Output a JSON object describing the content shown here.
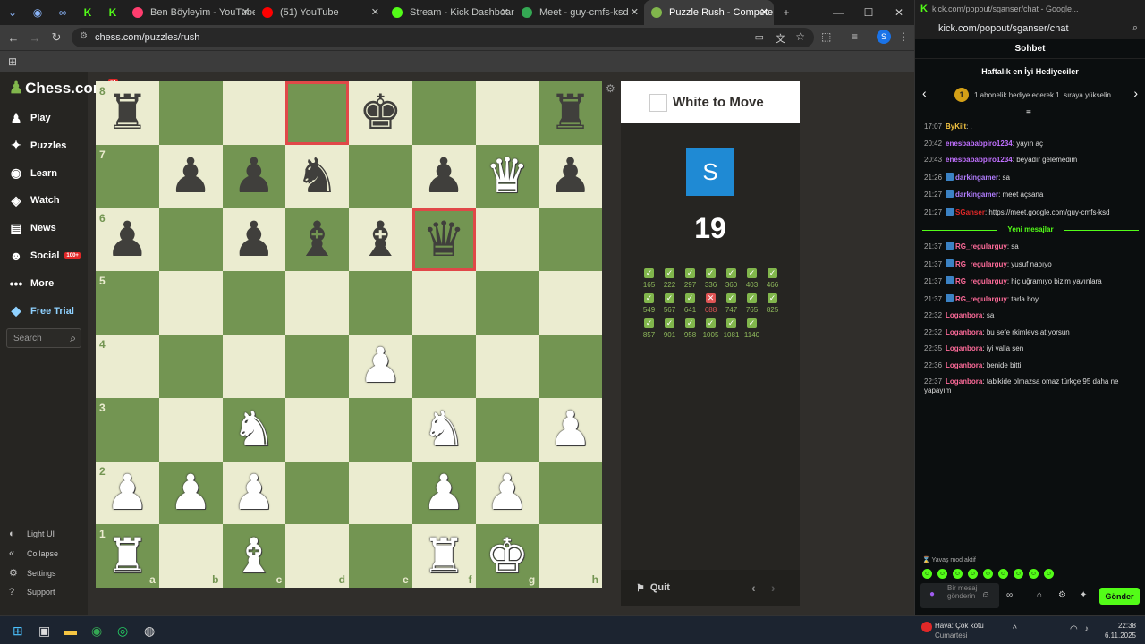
{
  "browser": {
    "tabs": [
      {
        "label": "Ben Böyleyim - YouTube",
        "color": "#ff3d6e"
      },
      {
        "label": "(51) YouTube",
        "color": "#ff0000"
      },
      {
        "label": "Stream - Kick Dashboard",
        "color": "#53fc18"
      },
      {
        "label": "Meet - guy-cmfs-ksd",
        "color": "#34a853"
      },
      {
        "label": "Puzzle Rush - Compete to S",
        "color": "#81b64c",
        "active": true
      }
    ],
    "url": "chess.com/puzzles/rush",
    "profile_initial": "S"
  },
  "sidebar": {
    "logo": "Chess.com",
    "logo_badge": "11",
    "items": [
      {
        "label": "Play",
        "icon": "play-icon",
        "glyph": "♟"
      },
      {
        "label": "Puzzles",
        "icon": "puzzle-icon",
        "glyph": "✦"
      },
      {
        "label": "Learn",
        "icon": "learn-icon",
        "glyph": "◉"
      },
      {
        "label": "Watch",
        "icon": "watch-icon",
        "glyph": "◈"
      },
      {
        "label": "News",
        "icon": "news-icon",
        "glyph": "▤"
      },
      {
        "label": "Social",
        "icon": "social-icon",
        "glyph": "☻",
        "tag": "100+"
      },
      {
        "label": "More",
        "icon": "more-icon",
        "glyph": "•••"
      },
      {
        "label": "Free Trial",
        "icon": "diamond-icon",
        "glyph": "◆"
      }
    ],
    "search_placeholder": "Search",
    "bottom": [
      {
        "label": "Light UI",
        "icon": "light-ui-icon",
        "glyph": "◐"
      },
      {
        "label": "Collapse",
        "icon": "collapse-icon",
        "glyph": "«"
      },
      {
        "label": "Settings",
        "icon": "gear-icon",
        "glyph": "⚙"
      },
      {
        "label": "Support",
        "icon": "help-icon",
        "glyph": "?"
      }
    ]
  },
  "board": {
    "ranks": [
      "8",
      "7",
      "6",
      "5",
      "4",
      "3",
      "2",
      "1"
    ],
    "files": [
      "a",
      "b",
      "c",
      "d",
      "e",
      "f",
      "g",
      "h"
    ],
    "position": [
      [
        "bR",
        "",
        "",
        "",
        "bK",
        "",
        "",
        "bR"
      ],
      [
        "",
        "bP",
        "bP",
        "bN",
        "",
        "bP",
        "wQ",
        "bP"
      ],
      [
        "bP",
        "",
        "bP",
        "bB",
        "bB",
        "bQ",
        "",
        ""
      ],
      [
        "",
        "",
        "",
        "",
        "",
        "",
        "",
        ""
      ],
      [
        "",
        "",
        "",
        "",
        "wP",
        "",
        "",
        ""
      ],
      [
        "",
        "",
        "wN",
        "",
        "",
        "wN",
        "",
        "wP"
      ],
      [
        "wP",
        "wP",
        "wP",
        "",
        "",
        "wP",
        "wP",
        ""
      ],
      [
        "wR",
        "",
        "wB",
        "",
        "",
        "wR",
        "wK",
        ""
      ]
    ],
    "highlighted": [
      "d8",
      "f6"
    ]
  },
  "panel": {
    "to_move": "White to Move",
    "avatar": "S",
    "score": "19",
    "results": [
      {
        "n": "165",
        "ok": true
      },
      {
        "n": "222",
        "ok": true
      },
      {
        "n": "297",
        "ok": true
      },
      {
        "n": "336",
        "ok": true
      },
      {
        "n": "360",
        "ok": true
      },
      {
        "n": "403",
        "ok": true
      },
      {
        "n": "466",
        "ok": true
      },
      {
        "n": "549",
        "ok": true
      },
      {
        "n": "567",
        "ok": true
      },
      {
        "n": "641",
        "ok": true
      },
      {
        "n": "688",
        "ok": false
      },
      {
        "n": "747",
        "ok": true
      },
      {
        "n": "765",
        "ok": true
      },
      {
        "n": "825",
        "ok": true
      },
      {
        "n": "857",
        "ok": true
      },
      {
        "n": "901",
        "ok": true
      },
      {
        "n": "958",
        "ok": true
      },
      {
        "n": "1005",
        "ok": true
      },
      {
        "n": "1081",
        "ok": true
      },
      {
        "n": "1140",
        "ok": true
      }
    ],
    "quit": "Quit"
  },
  "kick": {
    "window_title": "kick.com/popout/sganser/chat - Google...",
    "url": "kick.com/popout/sganser/chat",
    "header": "Sohbet",
    "gifters_title": "Haftalık en İyi Hediyeciler",
    "gifters_rank": "1",
    "gifters_text": "1 abonelik hediye ederek 1. sıraya yükselin",
    "new_messages": "Yeni mesajlar",
    "messages_old": [
      {
        "t": "17:07",
        "user": "ByKilt",
        "color": "#f5c542",
        "text": ".",
        "icon": false
      },
      {
        "t": "20:42",
        "user": "enesbababpiro1234",
        "color": "#c070ff",
        "text": "yayın aç",
        "icon": false
      },
      {
        "t": "20:43",
        "user": "enesbababpiro1234",
        "color": "#c070ff",
        "text": "beyadır gelemedim",
        "icon": false
      },
      {
        "t": "21:26",
        "user": "darkingamer",
        "color": "#b27dff",
        "text": "sa",
        "icon": true
      },
      {
        "t": "21:27",
        "user": "darkingamer",
        "color": "#b27dff",
        "text": "meet açsana",
        "icon": true
      },
      {
        "t": "21:27",
        "user": "SGanser",
        "color": "#e02828",
        "text": "https://meet.google.com/guy-cmfs-ksd",
        "icon": true
      }
    ],
    "messages_new": [
      {
        "t": "21:37",
        "user": "RG_regularguy",
        "color": "#ff6b9a",
        "text": "sa",
        "icon": true
      },
      {
        "t": "21:37",
        "user": "RG_regularguy",
        "color": "#ff6b9a",
        "text": "yusuf napıyo",
        "icon": true
      },
      {
        "t": "21:37",
        "user": "RG_regularguy",
        "color": "#ff6b9a",
        "text": "hiç uğramıyo bizim yayınlara",
        "icon": true
      },
      {
        "t": "21:37",
        "user": "RG_regularguy",
        "color": "#ff6b9a",
        "text": "tarla boy",
        "icon": true
      },
      {
        "t": "22:32",
        "user": "Loganbora",
        "color": "#ff6b9a",
        "text": "sa",
        "icon": false
      },
      {
        "t": "22:32",
        "user": "Loganbora",
        "color": "#ff6b9a",
        "text": "bu sefe rkimlevs atıyorsun",
        "icon": false
      },
      {
        "t": "22:35",
        "user": "Loganbora",
        "color": "#ff6b9a",
        "text": "iyi valla sen",
        "icon": false
      },
      {
        "t": "22:36",
        "user": "Loganbora",
        "color": "#ff6b9a",
        "text": "benide bitti",
        "icon": false
      },
      {
        "t": "22:37",
        "user": "Loganbora",
        "color": "#ff6b9a",
        "text": "tabikide olmazsa omaz türkçe 95 daha ne yapayım",
        "icon": false
      }
    ],
    "slow_mode": "Yavaş mod aktif",
    "input_placeholder": "Bir mesaj gönderin",
    "send": "Gönder"
  },
  "taskbar": {
    "weather": "Hava: Çok kötü",
    "weather_sub": "Cumartesi",
    "time": "22:38",
    "date": "6.11.2025"
  }
}
